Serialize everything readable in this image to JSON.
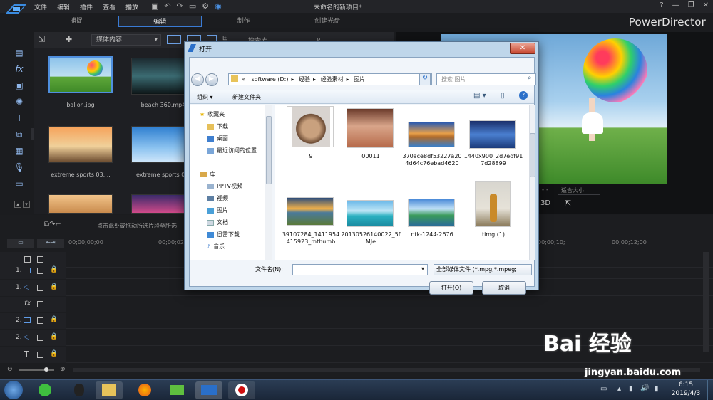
{
  "app": {
    "menu": [
      "文件",
      "编辑",
      "插件",
      "查看",
      "播放"
    ],
    "project_title": "未命名的新项目*",
    "brand": "PowerDirector",
    "win_controls": [
      "?",
      "—",
      "❐",
      "✕"
    ],
    "mode_tabs": [
      "捕捉",
      "编辑",
      "制作",
      "创建光盘"
    ],
    "active_tab": "编辑"
  },
  "library": {
    "filter": "媒体内容",
    "search_placeholder": "搜索库",
    "items": [
      "ballon.jpg",
      "beach 360.mp4",
      "extreme sports 03....",
      "extreme sports 0..."
    ]
  },
  "preview": {
    "aspect": "适合大小",
    "mode_3d": "3D"
  },
  "timeline": {
    "hint": "点击此处或拖动所选片段至所选",
    "times": [
      "00;00;00;00",
      "00;00;02;",
      "00;00;10;",
      "00;00;12;00"
    ],
    "tracks": [
      "1.",
      "1.",
      "fx",
      "2.",
      "2.",
      "T"
    ]
  },
  "dialog": {
    "title": "打开",
    "close": "✕",
    "address": [
      "«",
      "software (D:)",
      "经验",
      "经验素材",
      "图片"
    ],
    "search_placeholder": "搜索 图片",
    "organize": "组织 ▾",
    "new_folder": "新建文件夹",
    "nav": {
      "favorites": "收藏夹",
      "downloads": "下载",
      "desktop": "桌面",
      "recent": "最近访问的位置",
      "libraries": "库",
      "pptv": "PPTV视频",
      "videos": "视频",
      "pictures": "图片",
      "documents": "文档",
      "xunlei": "迅雷下载",
      "music": "音乐"
    },
    "files": [
      "9",
      "00011",
      "370ace8df53227a204d64c76ebad4620",
      "1440x900_2d7edf917d28899",
      "39107284_1411954415923_mthumb",
      "20130526140022_5fMJe",
      "ntk-1244-2676",
      "timg (1)"
    ],
    "filename_label": "文件名(N):",
    "filetype": "全部媒体文件 (*.mpg;*.mpeg;",
    "open_button": "打开(O)",
    "cancel_button": "取消"
  },
  "taskbar": {
    "time": "6:15",
    "date": "2019/4/3"
  },
  "watermark": {
    "logo": "Bai 经验",
    "url": "jingyan.baidu.com"
  }
}
